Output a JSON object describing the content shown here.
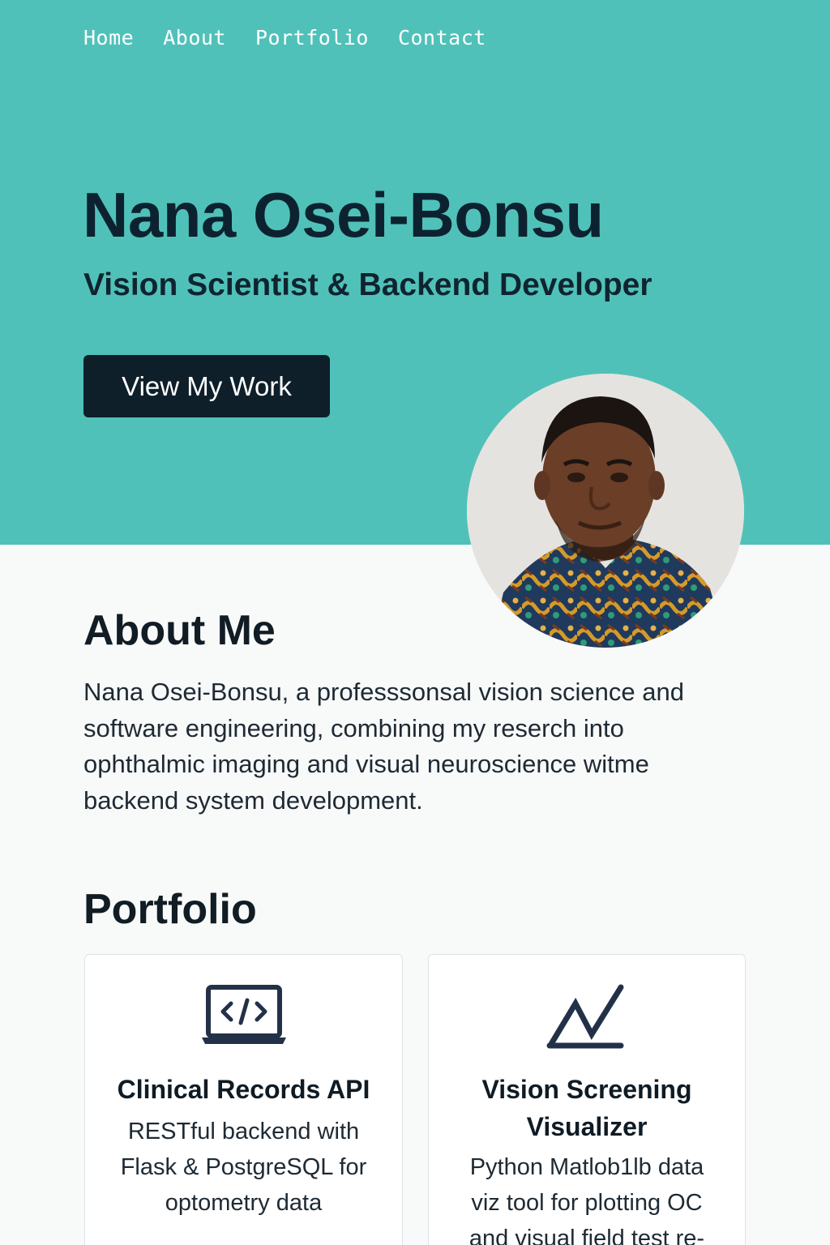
{
  "nav": {
    "items": [
      "Home",
      "About",
      "Portfolio",
      "Contact"
    ]
  },
  "hero": {
    "title": "Nana Osei-Bonsu",
    "subtitle": "Vision Scientist & Backend Developer",
    "cta_label": "View My Work"
  },
  "about": {
    "heading": "About Me",
    "text": "Nana Osei-Bonsu, a professsonsal vision science and software engineering, combining my reserch into ophthalmic imaging and visual neuroscience witme backend system development."
  },
  "portfolio": {
    "heading": "Portfolio",
    "cards": [
      {
        "icon": "code-laptop-icon",
        "title": "Clinical Records API",
        "description": "RESTful backend with Flask & PostgreSQL for optometry data"
      },
      {
        "icon": "line-chart-icon",
        "title": "Vision Screening Visualizer",
        "description": "Python Matlob1lb data viz tool for plotting OC and visual field test re-"
      }
    ]
  },
  "colors": {
    "hero_bg": "#50c1b9",
    "dark": "#0e1f2a",
    "page_bg": "#f8f9f9"
  }
}
